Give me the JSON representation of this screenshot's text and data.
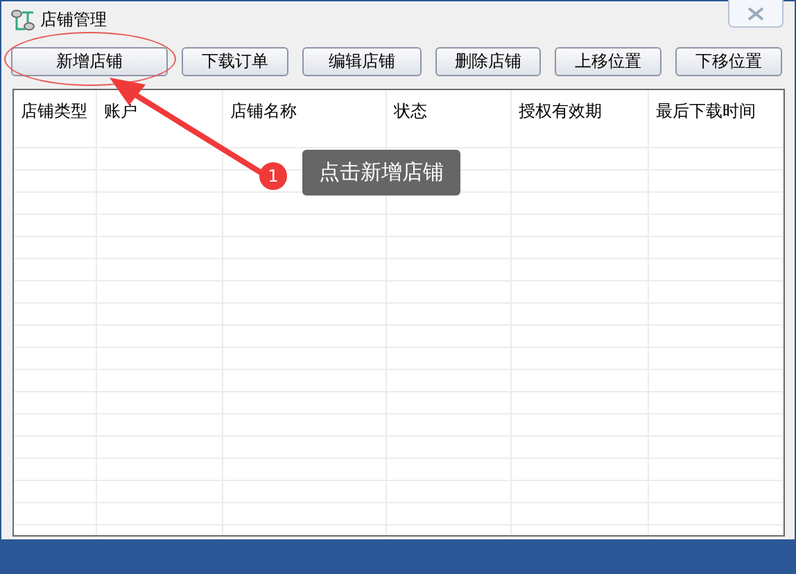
{
  "window": {
    "title": "店铺管理"
  },
  "toolbar": {
    "buttons": [
      {
        "label": "新增店铺",
        "highlighted": true
      },
      {
        "label": "下载订单",
        "highlighted": false
      },
      {
        "label": "编辑店铺",
        "highlighted": false
      },
      {
        "label": "删除店铺",
        "highlighted": false
      },
      {
        "label": "上移位置",
        "highlighted": false
      },
      {
        "label": "下移位置",
        "highlighted": false
      }
    ]
  },
  "table": {
    "columns": [
      "店铺类型",
      "账户",
      "店铺名称",
      "状态",
      "授权有效期",
      "最后下载时间"
    ]
  },
  "callout": {
    "step": "1",
    "text": "点击新增店铺"
  }
}
